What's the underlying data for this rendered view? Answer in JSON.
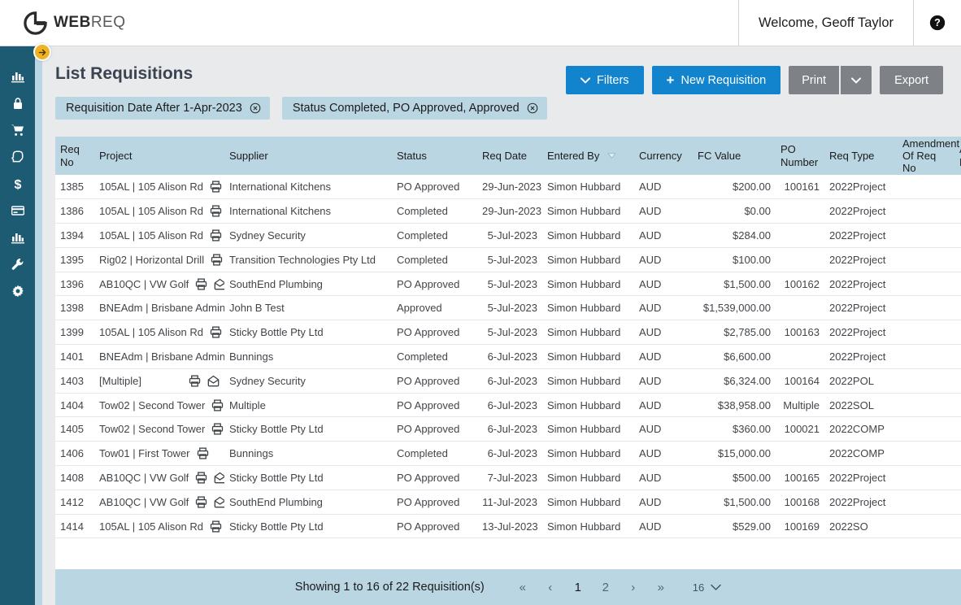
{
  "header": {
    "logo_bold": "WEB",
    "logo_light": "REQ",
    "welcome": "Welcome, Geoff Taylor",
    "help_icon": "help-circle-icon"
  },
  "sidebar": {
    "expand_icon": "arrow-right-circle-icon",
    "items": [
      {
        "icon": "bar-chart-icon",
        "name": "sidebar-item-dashboard"
      },
      {
        "icon": "lock-icon",
        "name": "sidebar-item-security"
      },
      {
        "icon": "shopping-cart-icon",
        "name": "sidebar-item-purchasing"
      },
      {
        "icon": "hand-pointer-icon",
        "name": "sidebar-item-approvals"
      },
      {
        "icon": "dollar-icon",
        "name": "sidebar-item-finance"
      },
      {
        "icon": "credit-card-icon",
        "name": "sidebar-item-payments"
      },
      {
        "icon": "bar-chart-icon-2",
        "name": "sidebar-item-reports"
      },
      {
        "icon": "wrench-icon",
        "name": "sidebar-item-tools"
      },
      {
        "icon": "gear-icon",
        "name": "sidebar-item-settings"
      }
    ]
  },
  "page": {
    "title": "List Requisitions"
  },
  "toolbar": {
    "filters_label": "Filters",
    "new_requisition_label": "New Requisition",
    "print_label": "Print",
    "export_label": "Export"
  },
  "filter_chips": [
    {
      "label": "Requisition Date After 1-Apr-2023"
    },
    {
      "label": "Status Completed, PO Approved, Approved"
    }
  ],
  "table": {
    "columns": [
      "Req No",
      "Project",
      "Supplier",
      "Status",
      "Req Date",
      "Entered By",
      "Currency",
      "FC Value",
      "PO Number",
      "Req Type",
      "Amendment Of Req No",
      "Am By"
    ],
    "sorted_column": "Entered By",
    "sort_direction": "desc",
    "rows": [
      {
        "req_no": "1385",
        "project": "105AL | 105 Alison Rd",
        "print": true,
        "mail": true,
        "supplier": "International Kitchens",
        "status": "PO Approved",
        "req_date": "29-Jun-2023",
        "entered_by": "Simon Hubbard",
        "currency": "AUD",
        "fc_value": "$200.00",
        "po_number": "100161",
        "req_type": "2022Project",
        "amendment": "",
        "am_by": ""
      },
      {
        "req_no": "1386",
        "project": "105AL | 105 Alison Rd",
        "print": true,
        "mail": false,
        "supplier": "International Kitchens",
        "status": "Completed",
        "req_date": "29-Jun-2023",
        "entered_by": "Simon Hubbard",
        "currency": "AUD",
        "fc_value": "$0.00",
        "po_number": "",
        "req_type": "2022Project",
        "amendment": "",
        "am_by": ""
      },
      {
        "req_no": "1394",
        "project": "105AL | 105 Alison Rd",
        "print": true,
        "mail": false,
        "supplier": "Sydney Security",
        "status": "Completed",
        "req_date": "5-Jul-2023",
        "entered_by": "Simon Hubbard",
        "currency": "AUD",
        "fc_value": "$284.00",
        "po_number": "",
        "req_type": "2022Project",
        "amendment": "",
        "am_by": ""
      },
      {
        "req_no": "1395",
        "project": "Rig02 | Horizontal Drill",
        "print": true,
        "mail": false,
        "supplier": "Transition Technologies Pty Ltd",
        "status": "Completed",
        "req_date": "5-Jul-2023",
        "entered_by": "Simon Hubbard",
        "currency": "AUD",
        "fc_value": "$100.00",
        "po_number": "",
        "req_type": "2022Project",
        "amendment": "",
        "am_by": ""
      },
      {
        "req_no": "1396",
        "project": "AB10QC | VW Golf",
        "print": true,
        "mail": true,
        "supplier": "SouthEnd Plumbing",
        "status": "PO Approved",
        "req_date": "5-Jul-2023",
        "entered_by": "Simon Hubbard",
        "currency": "AUD",
        "fc_value": "$1,500.00",
        "po_number": "100162",
        "req_type": "2022Project",
        "amendment": "",
        "am_by": ""
      },
      {
        "req_no": "1398",
        "project": "BNEAdm | Brisbane Admin",
        "print": true,
        "mail": false,
        "supplier": "John B Test",
        "status": "Approved",
        "req_date": "5-Jul-2023",
        "entered_by": "Simon Hubbard",
        "currency": "AUD",
        "fc_value": "$1,539,000.00",
        "po_number": "",
        "req_type": "2022Project",
        "amendment": "",
        "am_by": ""
      },
      {
        "req_no": "1399",
        "project": "105AL | 105 Alison Rd",
        "print": true,
        "mail": true,
        "supplier": "Sticky Bottle Pty Ltd",
        "status": "PO Approved",
        "req_date": "5-Jul-2023",
        "entered_by": "Simon Hubbard",
        "currency": "AUD",
        "fc_value": "$2,785.00",
        "po_number": "100163",
        "req_type": "2022Project",
        "amendment": "",
        "am_by": ""
      },
      {
        "req_no": "1401",
        "project": "BNEAdm | Brisbane Admin",
        "print": true,
        "mail": false,
        "supplier": "Bunnings",
        "status": "Completed",
        "req_date": "6-Jul-2023",
        "entered_by": "Simon Hubbard",
        "currency": "AUD",
        "fc_value": "$6,600.00",
        "po_number": "",
        "req_type": "2022Project",
        "amendment": "",
        "am_by": ""
      },
      {
        "req_no": "1403",
        "project": "[Multiple]",
        "print": true,
        "mail": true,
        "supplier": "Sydney Security",
        "status": "PO Approved",
        "req_date": "6-Jul-2023",
        "entered_by": "Simon Hubbard",
        "currency": "AUD",
        "fc_value": "$6,324.00",
        "po_number": "100164",
        "req_type": "2022POL",
        "amendment": "",
        "am_by": ""
      },
      {
        "req_no": "1404",
        "project": "Tow02 | Second Tower",
        "print": true,
        "mail": true,
        "supplier": "Multiple",
        "status": "PO Approved",
        "req_date": "6-Jul-2023",
        "entered_by": "Simon Hubbard",
        "currency": "AUD",
        "fc_value": "$38,958.00",
        "po_number": "Multiple",
        "req_type": "2022SOL",
        "amendment": "",
        "am_by": ""
      },
      {
        "req_no": "1405",
        "project": "Tow02 | Second Tower",
        "print": true,
        "mail": true,
        "supplier": "Sticky Bottle Pty Ltd",
        "status": "PO Approved",
        "req_date": "6-Jul-2023",
        "entered_by": "Simon Hubbard",
        "currency": "AUD",
        "fc_value": "$360.00",
        "po_number": "100021",
        "req_type": "2022COMP",
        "amendment": "",
        "am_by": ""
      },
      {
        "req_no": "1406",
        "project": "Tow01 | First Tower",
        "print": true,
        "mail": false,
        "supplier": "Bunnings",
        "status": "Completed",
        "req_date": "6-Jul-2023",
        "entered_by": "Simon Hubbard",
        "currency": "AUD",
        "fc_value": "$15,000.00",
        "po_number": "",
        "req_type": "2022COMP",
        "amendment": "",
        "am_by": ""
      },
      {
        "req_no": "1408",
        "project": "AB10QC | VW Golf",
        "print": true,
        "mail": true,
        "supplier": "Sticky Bottle Pty Ltd",
        "status": "PO Approved",
        "req_date": "7-Jul-2023",
        "entered_by": "Simon Hubbard",
        "currency": "AUD",
        "fc_value": "$500.00",
        "po_number": "100165",
        "req_type": "2022Project",
        "amendment": "",
        "am_by": ""
      },
      {
        "req_no": "1412",
        "project": "AB10QC | VW Golf",
        "print": true,
        "mail": true,
        "supplier": "SouthEnd Plumbing",
        "status": "PO Approved",
        "req_date": "11-Jul-2023",
        "entered_by": "Simon Hubbard",
        "currency": "AUD",
        "fc_value": "$1,500.00",
        "po_number": "100168",
        "req_type": "2022Project",
        "amendment": "",
        "am_by": ""
      },
      {
        "req_no": "1414",
        "project": "105AL | 105 Alison Rd",
        "print": true,
        "mail": true,
        "supplier": "Sticky Bottle Pty Ltd",
        "status": "PO Approved",
        "req_date": "13-Jul-2023",
        "entered_by": "Simon Hubbard",
        "currency": "AUD",
        "fc_value": "$529.00",
        "po_number": "100169",
        "req_type": "2022SO",
        "amendment": "",
        "am_by": ""
      }
    ]
  },
  "pagination": {
    "summary": "Showing 1 to 16 of 22 Requisition(s)",
    "first_label": "«",
    "prev_label": "‹",
    "pages": [
      "1",
      "2"
    ],
    "active_page": "1",
    "next_label": "›",
    "last_label": "»",
    "page_size": "16"
  },
  "colors": {
    "sidebar": "#1d5b72",
    "accent_blue": "#1184cd",
    "grey_button": "#7e8286",
    "table_header": "#b9d6e2",
    "expand_button": "#f0b323"
  }
}
